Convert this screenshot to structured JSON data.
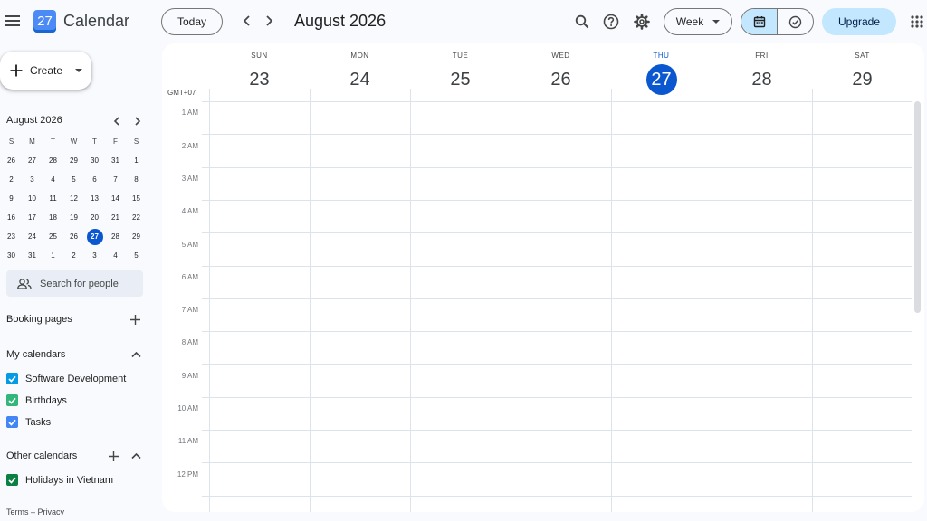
{
  "app": {
    "logo_text": "27",
    "title": "Calendar"
  },
  "toolbar": {
    "today_label": "Today",
    "month_title": "August 2026",
    "view_label": "Week",
    "upgrade_label": "Upgrade"
  },
  "sidebar": {
    "create_label": "Create",
    "mini_calendar": {
      "title": "August 2026",
      "weekdays": [
        "S",
        "M",
        "T",
        "W",
        "T",
        "F",
        "S"
      ],
      "weeks": [
        [
          "26",
          "27",
          "28",
          "29",
          "30",
          "31",
          "1"
        ],
        [
          "2",
          "3",
          "4",
          "5",
          "6",
          "7",
          "8"
        ],
        [
          "9",
          "10",
          "11",
          "12",
          "13",
          "14",
          "15"
        ],
        [
          "16",
          "17",
          "18",
          "19",
          "20",
          "21",
          "22"
        ],
        [
          "23",
          "24",
          "25",
          "26",
          "27",
          "28",
          "29"
        ],
        [
          "30",
          "31",
          "1",
          "2",
          "3",
          "4",
          "5"
        ]
      ],
      "today": "27"
    },
    "search_people_placeholder": "Search for people",
    "booking_pages_label": "Booking pages",
    "my_calendars_label": "My calendars",
    "my_calendars": [
      {
        "name": "Software Development",
        "color": "#039be5"
      },
      {
        "name": "Birthdays",
        "color": "#33b679"
      },
      {
        "name": "Tasks",
        "color": "#4285f4"
      }
    ],
    "other_calendars_label": "Other calendars",
    "other_calendars": [
      {
        "name": "Holidays in Vietnam",
        "color": "#0b8043"
      }
    ],
    "footer": {
      "terms": "Terms",
      "separator": "–",
      "privacy": "Privacy"
    }
  },
  "week": {
    "timezone": "GMT+07",
    "days": [
      {
        "name": "SUN",
        "num": "23"
      },
      {
        "name": "MON",
        "num": "24"
      },
      {
        "name": "TUE",
        "num": "25"
      },
      {
        "name": "WED",
        "num": "26"
      },
      {
        "name": "THU",
        "num": "27"
      },
      {
        "name": "FRI",
        "num": "28"
      },
      {
        "name": "SAT",
        "num": "29"
      }
    ],
    "today_index": 4,
    "hours": [
      "1 AM",
      "2 AM",
      "3 AM",
      "4 AM",
      "5 AM",
      "6 AM",
      "7 AM",
      "8 AM",
      "9 AM",
      "10 AM",
      "11 AM",
      "12 PM"
    ]
  },
  "colors": {
    "accent": "#0b57d0",
    "toggle_active": "#c2e7ff",
    "surface": "#f8fafd"
  }
}
